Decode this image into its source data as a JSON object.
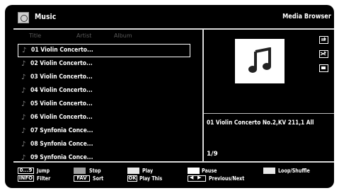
{
  "header": {
    "app_title": "Music",
    "mode_label": "Media Browser"
  },
  "columns": [
    "Title",
    "Artist",
    "Album"
  ],
  "tracks": [
    {
      "name": "01 Violin Concerto...",
      "selected": true
    },
    {
      "name": "02 Violin Concerto..."
    },
    {
      "name": "03 Violin Concerto..."
    },
    {
      "name": "04 Violin Concerto..."
    },
    {
      "name": "05 Violin Concerto..."
    },
    {
      "name": "06 Violin Concerto..."
    },
    {
      "name": "07 Synfonia Conce..."
    },
    {
      "name": "08 Synfonia Conce..."
    },
    {
      "name": "09 Synfonia Conce..."
    }
  ],
  "now_playing": "01 Violin Concerto No.2,KV 211,1 All",
  "position": "1/9",
  "side_icons": [
    "repeat-icon",
    "shuffle-icon",
    "stop-icon"
  ],
  "legend": {
    "jump_key": "0...9",
    "jump_label": "Jump",
    "info_key": "INFO",
    "filter_label": "Filter",
    "stop_label": "Stop",
    "fav_key": "FAV",
    "sort_label": "Sort",
    "play_label": "Play",
    "ok_key": "OK",
    "play_this_label": "Play This",
    "pause_label": "Pause",
    "prev_next_label": "Previous/Next",
    "loop_label": "Loop/Shuffle"
  },
  "colors": {
    "background": "#000000",
    "text": "#ffffff",
    "column_header": "#5a5a5a",
    "divider": "#d9d9d9"
  }
}
